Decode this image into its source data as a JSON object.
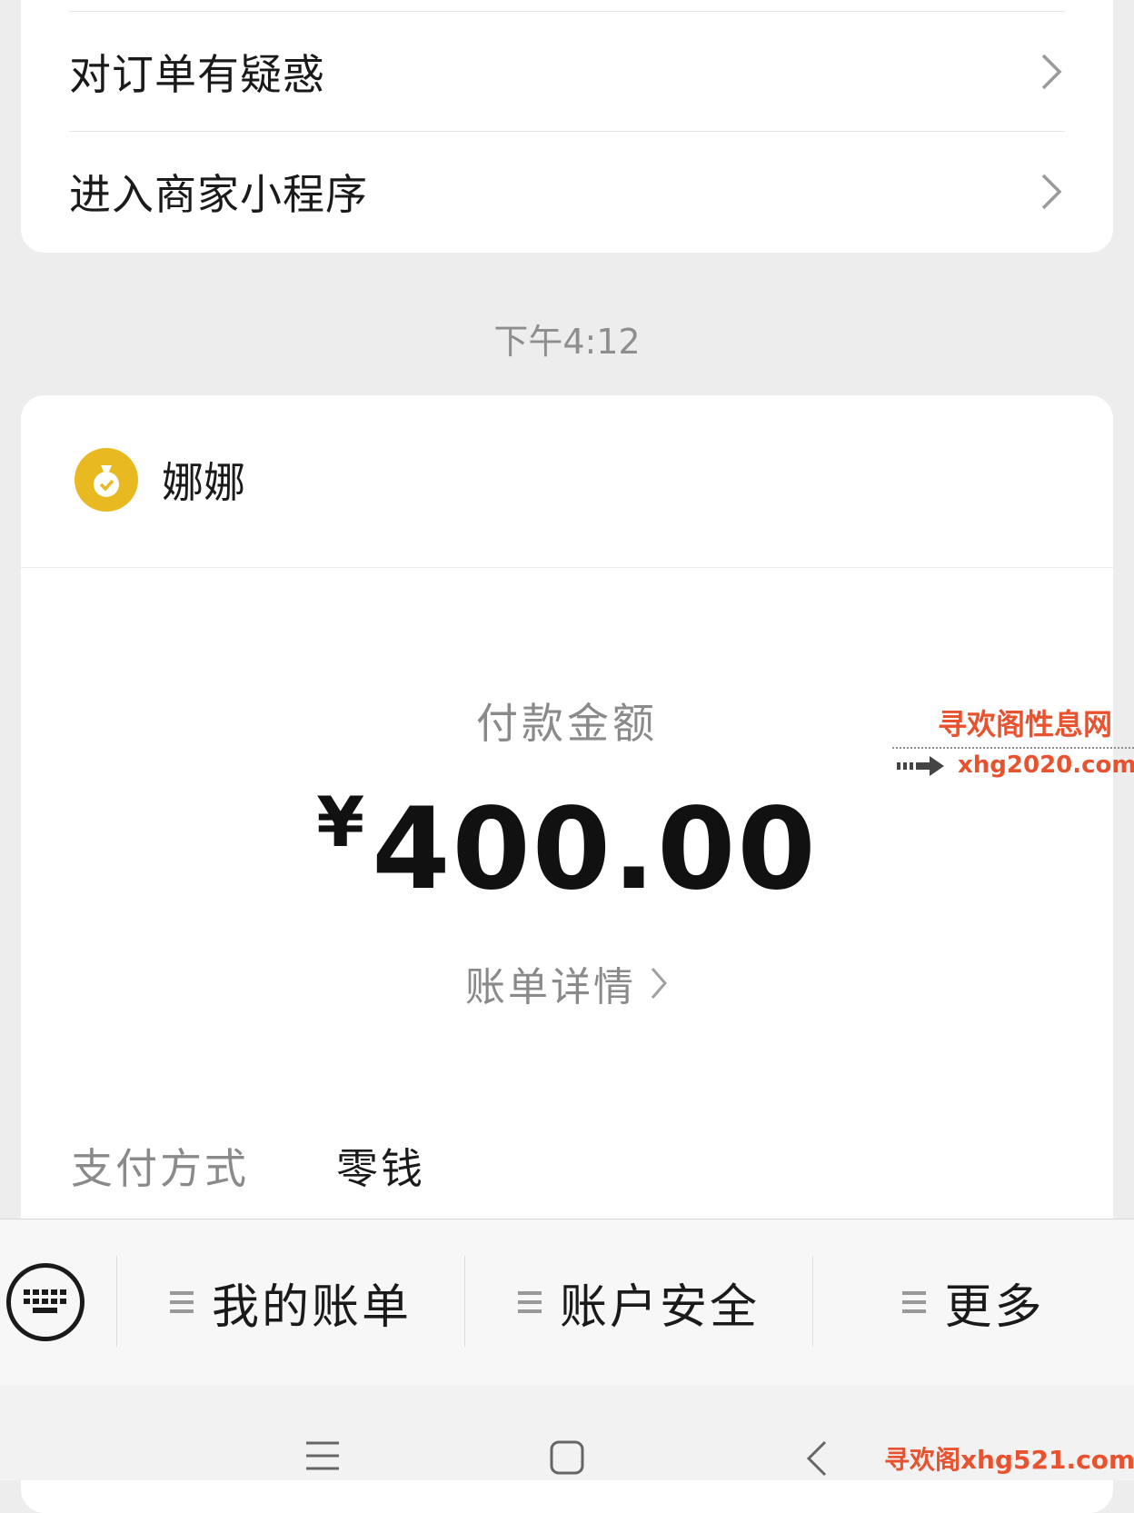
{
  "order_menu": {
    "items": [
      {
        "label": "对订单有疑惑"
      },
      {
        "label": "进入商家小程序"
      }
    ]
  },
  "timestamp": "下午4:12",
  "payment": {
    "merchant_name": "娜娜",
    "amount_label": "付款金额",
    "currency": "¥",
    "amount": "400.00",
    "bill_detail_label": "账单详情",
    "method_label": "支付方式",
    "method_value": "零钱",
    "brand_color": "#e8b921"
  },
  "watermark": {
    "title": "寻欢阁性息网",
    "url": "xhg2020.com",
    "bottom": "寻欢阁xhg521.com"
  },
  "menu_bar": {
    "items": [
      {
        "label": "我的账单"
      },
      {
        "label": "账户安全"
      },
      {
        "label": "更多"
      }
    ]
  },
  "icons": {
    "keyboard": "keyboard-icon",
    "chevron": "chevron-right-icon",
    "menu": "menu-lines-icon",
    "nav_recent": "recent-apps-icon",
    "nav_home": "home-icon",
    "nav_back": "back-icon"
  }
}
